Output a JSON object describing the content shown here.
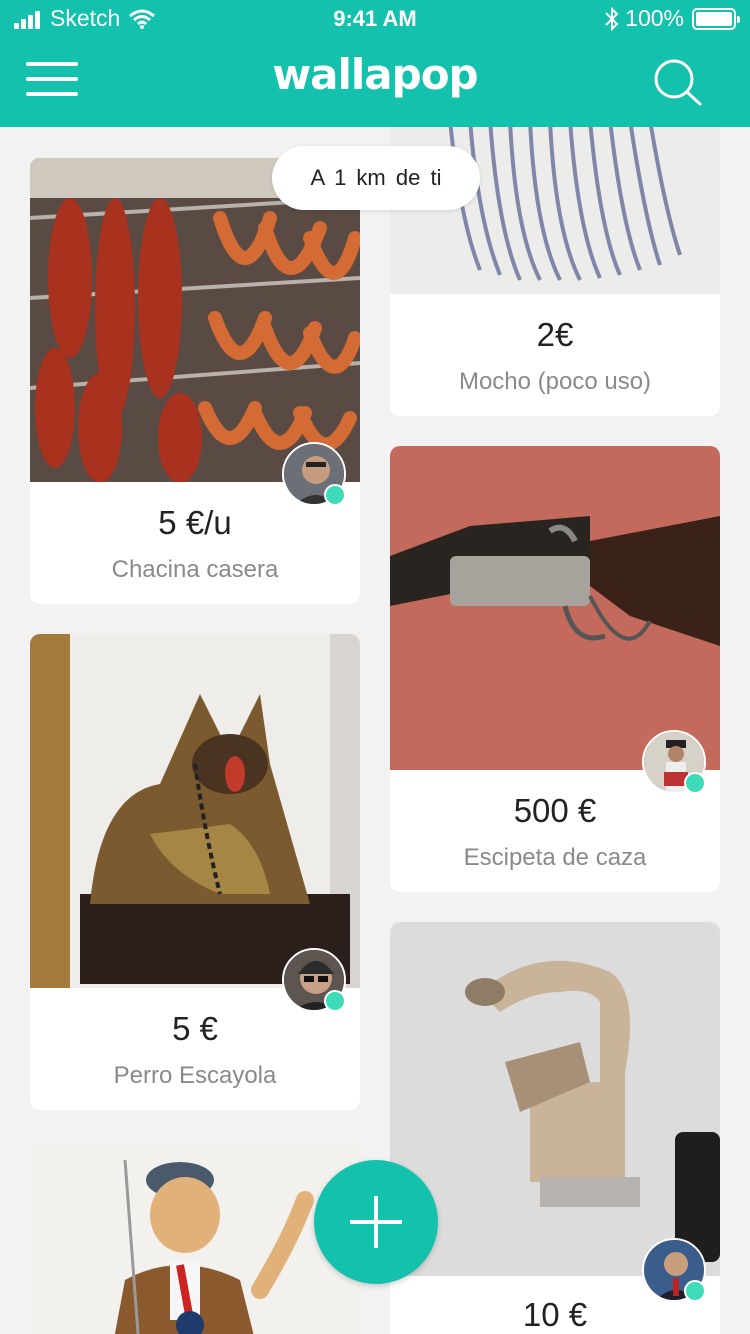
{
  "status_bar": {
    "carrier": "Sketch",
    "time": "9:41 AM",
    "battery": "100%"
  },
  "header": {
    "logo": "wallapop"
  },
  "location_filter": {
    "label": "A 1 km de ti"
  },
  "colors": {
    "brand": "#13c1ac",
    "online": "#3ddbb7"
  },
  "products": [
    {
      "price": "5 €/u",
      "title": "Chacina casera"
    },
    {
      "price": "2€",
      "title": "Mocho (poco uso)"
    },
    {
      "price": "500 €",
      "title": "Escipeta de caza"
    },
    {
      "price": "5 €",
      "title": "Perro Escayola"
    },
    {
      "price": "10 €",
      "title": ""
    }
  ],
  "fab": {
    "icon": "plus-icon"
  }
}
